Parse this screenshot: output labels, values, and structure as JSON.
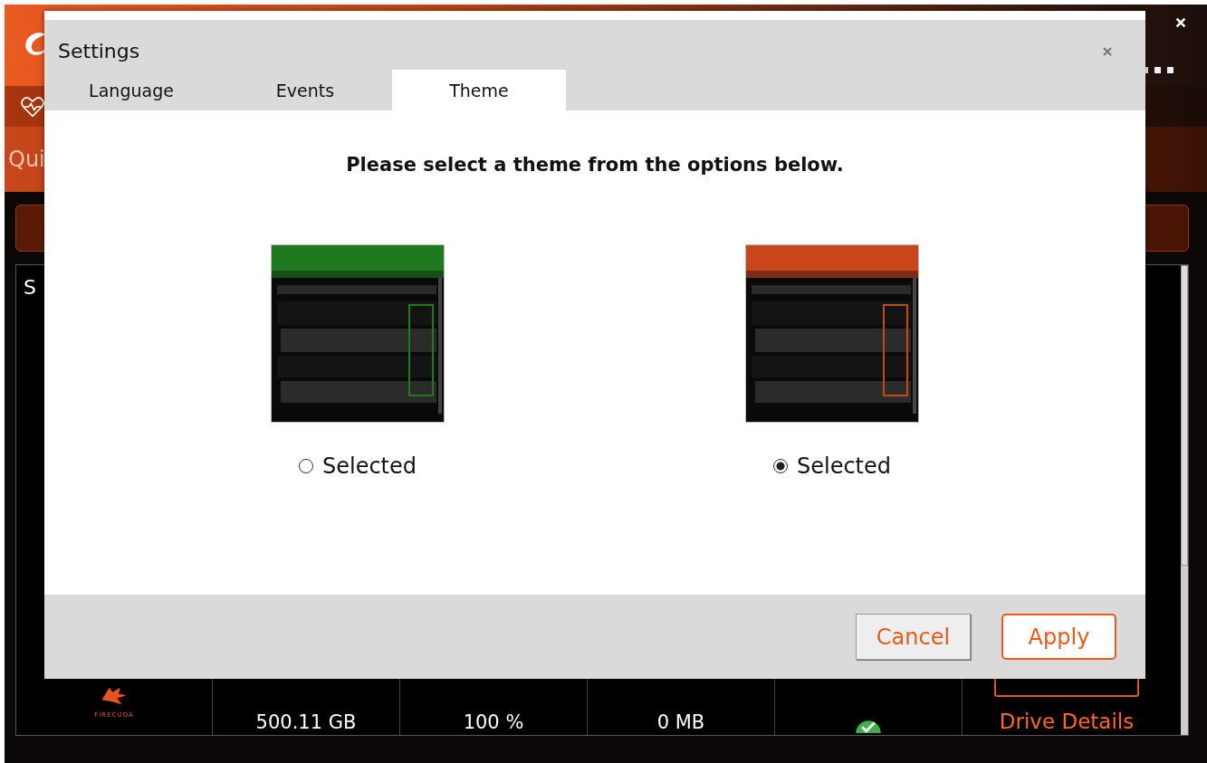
{
  "app": {
    "nav_label": "Qui",
    "panel_label": "S",
    "drive": {
      "brand": "FIRECUDA",
      "columns": [
        {
          "kind": "text",
          "value": "500.11 GB"
        },
        {
          "kind": "text",
          "value": "100 %"
        },
        {
          "kind": "text",
          "value": "0 MB"
        },
        {
          "kind": "status"
        }
      ],
      "drive_details": "Drive Details"
    }
  },
  "dialog": {
    "title": "Settings",
    "tabs": [
      {
        "label": "Language",
        "selected": false
      },
      {
        "label": "Events",
        "selected": false
      },
      {
        "label": "Theme",
        "selected": true
      }
    ],
    "prompt": "Please select a theme from the options below.",
    "themes": [
      {
        "kind": "picture",
        "label": "Selected",
        "selected": false,
        "color": "#1f7a1f"
      },
      {
        "kind": "picture",
        "label": "Selected",
        "selected": true,
        "color": "#c8461a"
      }
    ],
    "buttons": [
      {
        "kind": "secondary",
        "label": "Cancel"
      },
      {
        "kind": "primary",
        "label": "Apply"
      }
    ]
  }
}
